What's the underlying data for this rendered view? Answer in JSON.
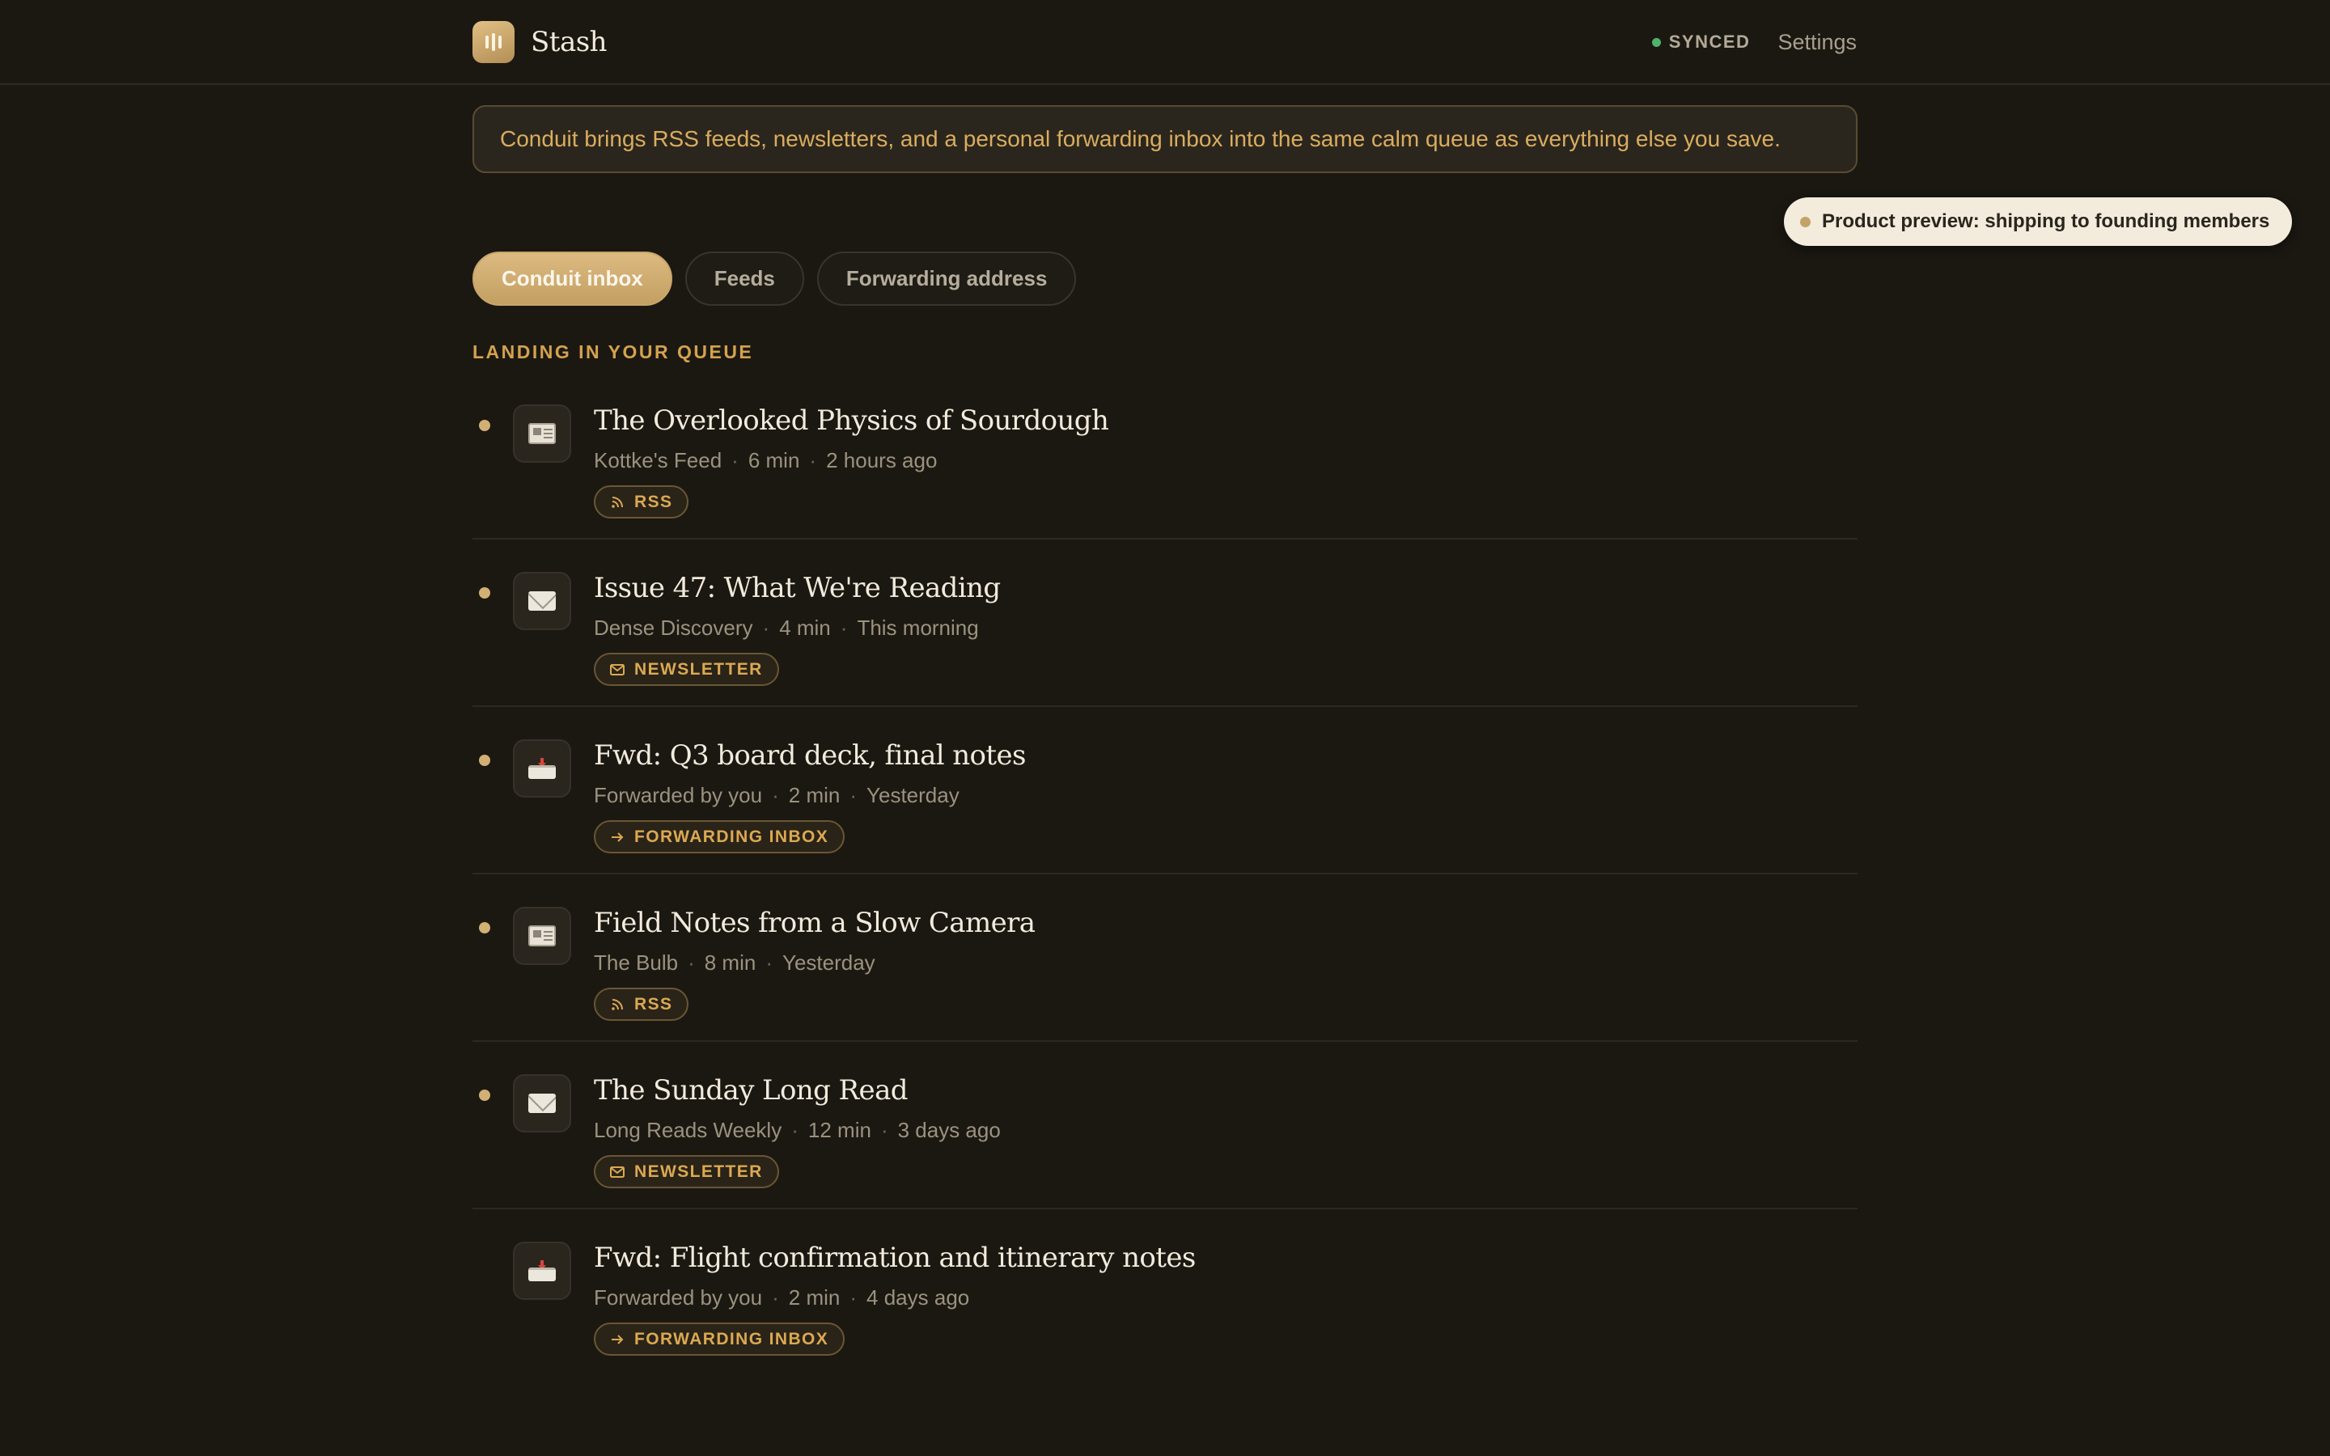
{
  "app": {
    "name": "Stash"
  },
  "header": {
    "sync_status": "SYNCED",
    "settings_label": "Settings"
  },
  "banner": {
    "text": "Conduit brings RSS feeds, newsletters, and a personal forwarding inbox into the same calm queue as everything else you save."
  },
  "preview_pill": {
    "text": "Product preview: shipping to founding members"
  },
  "tabs": [
    {
      "label": "Conduit inbox",
      "active": true
    },
    {
      "label": "Feeds",
      "active": false
    },
    {
      "label": "Forwarding address",
      "active": false
    }
  ],
  "section_label": "LANDING IN YOUR QUEUE",
  "colors": {
    "background": "#1b1812",
    "accent": "#d4a24e",
    "synced": "#52b26a",
    "tab_active": "#c9a56a"
  },
  "items": [
    {
      "title": "The Overlooked Physics of Sourdough",
      "source": "Kottke's Feed",
      "read_time": "6 min",
      "when": "2 hours ago",
      "badge": "RSS",
      "icon": "newspaper-icon",
      "unread": true
    },
    {
      "title": "Issue 47: What We're Reading",
      "source": "Dense Discovery",
      "read_time": "4 min",
      "when": "This morning",
      "badge": "NEWSLETTER",
      "icon": "envelope-icon",
      "unread": true
    },
    {
      "title": "Fwd: Q3 board deck, final notes",
      "source": "Forwarded by you",
      "read_time": "2 min",
      "when": "Yesterday",
      "badge": "FORWARDING INBOX",
      "icon": "inbox-tray-icon",
      "unread": true
    },
    {
      "title": "Field Notes from a Slow Camera",
      "source": "The Bulb",
      "read_time": "8 min",
      "when": "Yesterday",
      "badge": "RSS",
      "icon": "newspaper-icon",
      "unread": true
    },
    {
      "title": "The Sunday Long Read",
      "source": "Long Reads Weekly",
      "read_time": "12 min",
      "when": "3 days ago",
      "badge": "NEWSLETTER",
      "icon": "envelope-icon",
      "unread": true
    },
    {
      "title": "Fwd: Flight confirmation and itinerary notes",
      "source": "Forwarded by you",
      "read_time": "2 min",
      "when": "4 days ago",
      "badge": "FORWARDING INBOX",
      "icon": "inbox-tray-icon",
      "unread": false
    }
  ]
}
